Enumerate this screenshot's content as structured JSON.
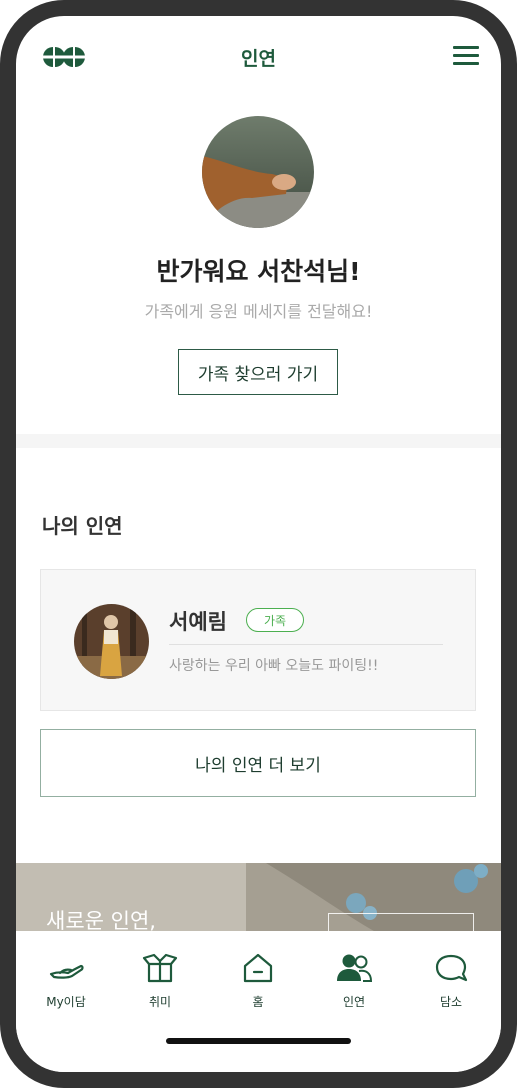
{
  "header": {
    "title": "인연"
  },
  "profile": {
    "greeting": "반가워요 서찬석님!",
    "subtitle": "가족에게 응원 메세지를 전달해요!",
    "find_button": "가족 찾으러 가기"
  },
  "section": {
    "title": "나의 인연"
  },
  "connection": {
    "name": "서예림",
    "badge": "가족",
    "message": "사랑하는 우리 아빠 오늘도 파이팅!!"
  },
  "more_button": "나의 인연 더 보기",
  "banner": {
    "text": "새로운 인연,"
  },
  "tabs": [
    {
      "label": "My이담",
      "icon": "hand-icon"
    },
    {
      "label": "취미",
      "icon": "box-icon"
    },
    {
      "label": "홈",
      "icon": "home-icon"
    },
    {
      "label": "인연",
      "icon": "people-icon"
    },
    {
      "label": "담소",
      "icon": "chat-bubble-icon"
    }
  ],
  "colors": {
    "brand": "#1e5a3c",
    "badge": "#4caf50",
    "frame": "#333333"
  }
}
